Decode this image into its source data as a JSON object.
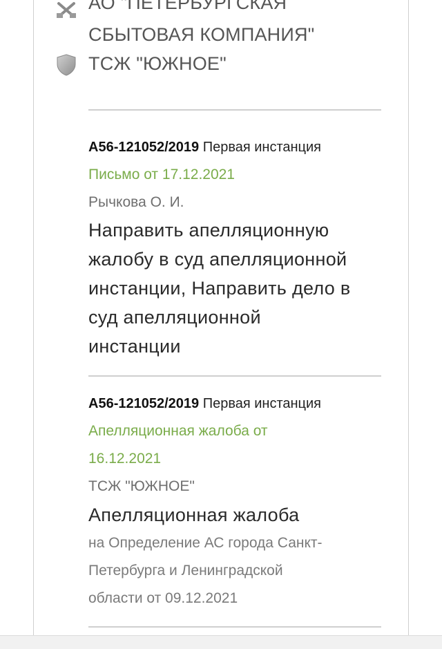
{
  "participants": {
    "plaintiff_line1": "АО \"ПЕТЕРБУРГСКАЯ",
    "plaintiff_line2": "СБЫТОВАЯ КОМПАНИЯ\"",
    "defendant": "ТСЖ \"ЮЖНОЕ\""
  },
  "events": [
    {
      "case_number": "А56-121052/2019",
      "instance": "Первая инстанция",
      "document": "Письмо от 17.12.2021",
      "author": "Рычкова О. И.",
      "summary": [
        "Направить апелляционную",
        "жалобу в суд апелляционной",
        "инстанции, Направить дело в",
        "суд апелляционной",
        "инстанции"
      ]
    },
    {
      "case_number": "А56-121052/2019",
      "instance": "Первая инстанция",
      "document_line1": "Апелляционная жалоба от",
      "document_line2": "16.12.2021",
      "author": "ТСЖ \"ЮЖНОЕ\"",
      "summary": "Апелляционная жалоба",
      "description": [
        "на Определение АС города Санкт-",
        "Петербурга и Ленинградской",
        "области от 09.12.2021"
      ]
    }
  ]
}
